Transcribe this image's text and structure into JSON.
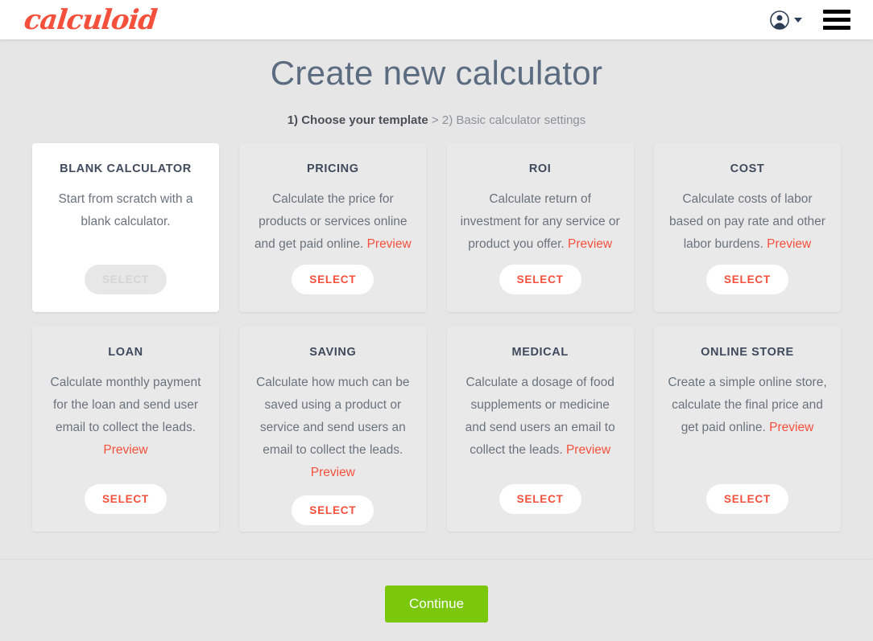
{
  "header": {
    "logo_text": "calculoid",
    "logo_color": "#f4503c",
    "user_menu_label": "",
    "icons": {
      "avatar": "user-avatar-icon",
      "caret": "chevron-down-icon",
      "menu": "hamburger-menu-icon"
    }
  },
  "page": {
    "title": "Create new calculator",
    "breadcrumb": {
      "step1": "1) Choose your template",
      "separator": " > ",
      "step2": "2) Basic calculator settings"
    }
  },
  "templates": [
    {
      "title": "BLANK CALCULATOR",
      "desc_before": "Start from scratch with a blank calculator.",
      "preview_label": "",
      "desc_after": "",
      "select_label": "SELECT",
      "selected": true,
      "disabled": true
    },
    {
      "title": "PRICING",
      "desc_before": "Calculate the price for products or services online and get paid online. ",
      "preview_label": "Preview",
      "desc_after": "",
      "select_label": "SELECT",
      "selected": false,
      "disabled": false
    },
    {
      "title": "ROI",
      "desc_before": "Calculate return of investment for any service or product you offer. ",
      "preview_label": "Preview",
      "desc_after": "",
      "select_label": "SELECT",
      "selected": false,
      "disabled": false
    },
    {
      "title": "COST",
      "desc_before": "Calculate costs of labor based on pay rate and other labor burdens. ",
      "preview_label": "Preview",
      "desc_after": "",
      "select_label": "SELECT",
      "selected": false,
      "disabled": false
    },
    {
      "title": "LOAN",
      "desc_before": "Calculate monthly payment for the loan and send user email to collect the leads. ",
      "preview_label": "Preview",
      "desc_after": "",
      "select_label": "SELECT",
      "selected": false,
      "disabled": false
    },
    {
      "title": "SAVING",
      "desc_before": "Calculate how much can be saved using a product or service and send users an email to collect the leads. ",
      "preview_label": "Preview",
      "desc_after": "",
      "select_label": "SELECT",
      "selected": false,
      "disabled": false
    },
    {
      "title": "MEDICAL",
      "desc_before": "Calculate a dosage of food supplements or medicine and send users an email to collect the leads. ",
      "preview_label": "Preview",
      "desc_after": "",
      "select_label": "SELECT",
      "selected": false,
      "disabled": false
    },
    {
      "title": "ONLINE STORE",
      "desc_before": "Create a simple online store, calculate the final price and get paid online. ",
      "preview_label": "Preview",
      "desc_after": "",
      "select_label": "SELECT",
      "selected": false,
      "disabled": false
    }
  ],
  "footer": {
    "continue_label": "Continue",
    "continue_color": "#7ac70c"
  },
  "colors": {
    "accent": "#f4503c",
    "title": "#5b6b80",
    "background": "#e6e6e6",
    "card": "#e9e9e9",
    "card_selected": "#ffffff"
  }
}
